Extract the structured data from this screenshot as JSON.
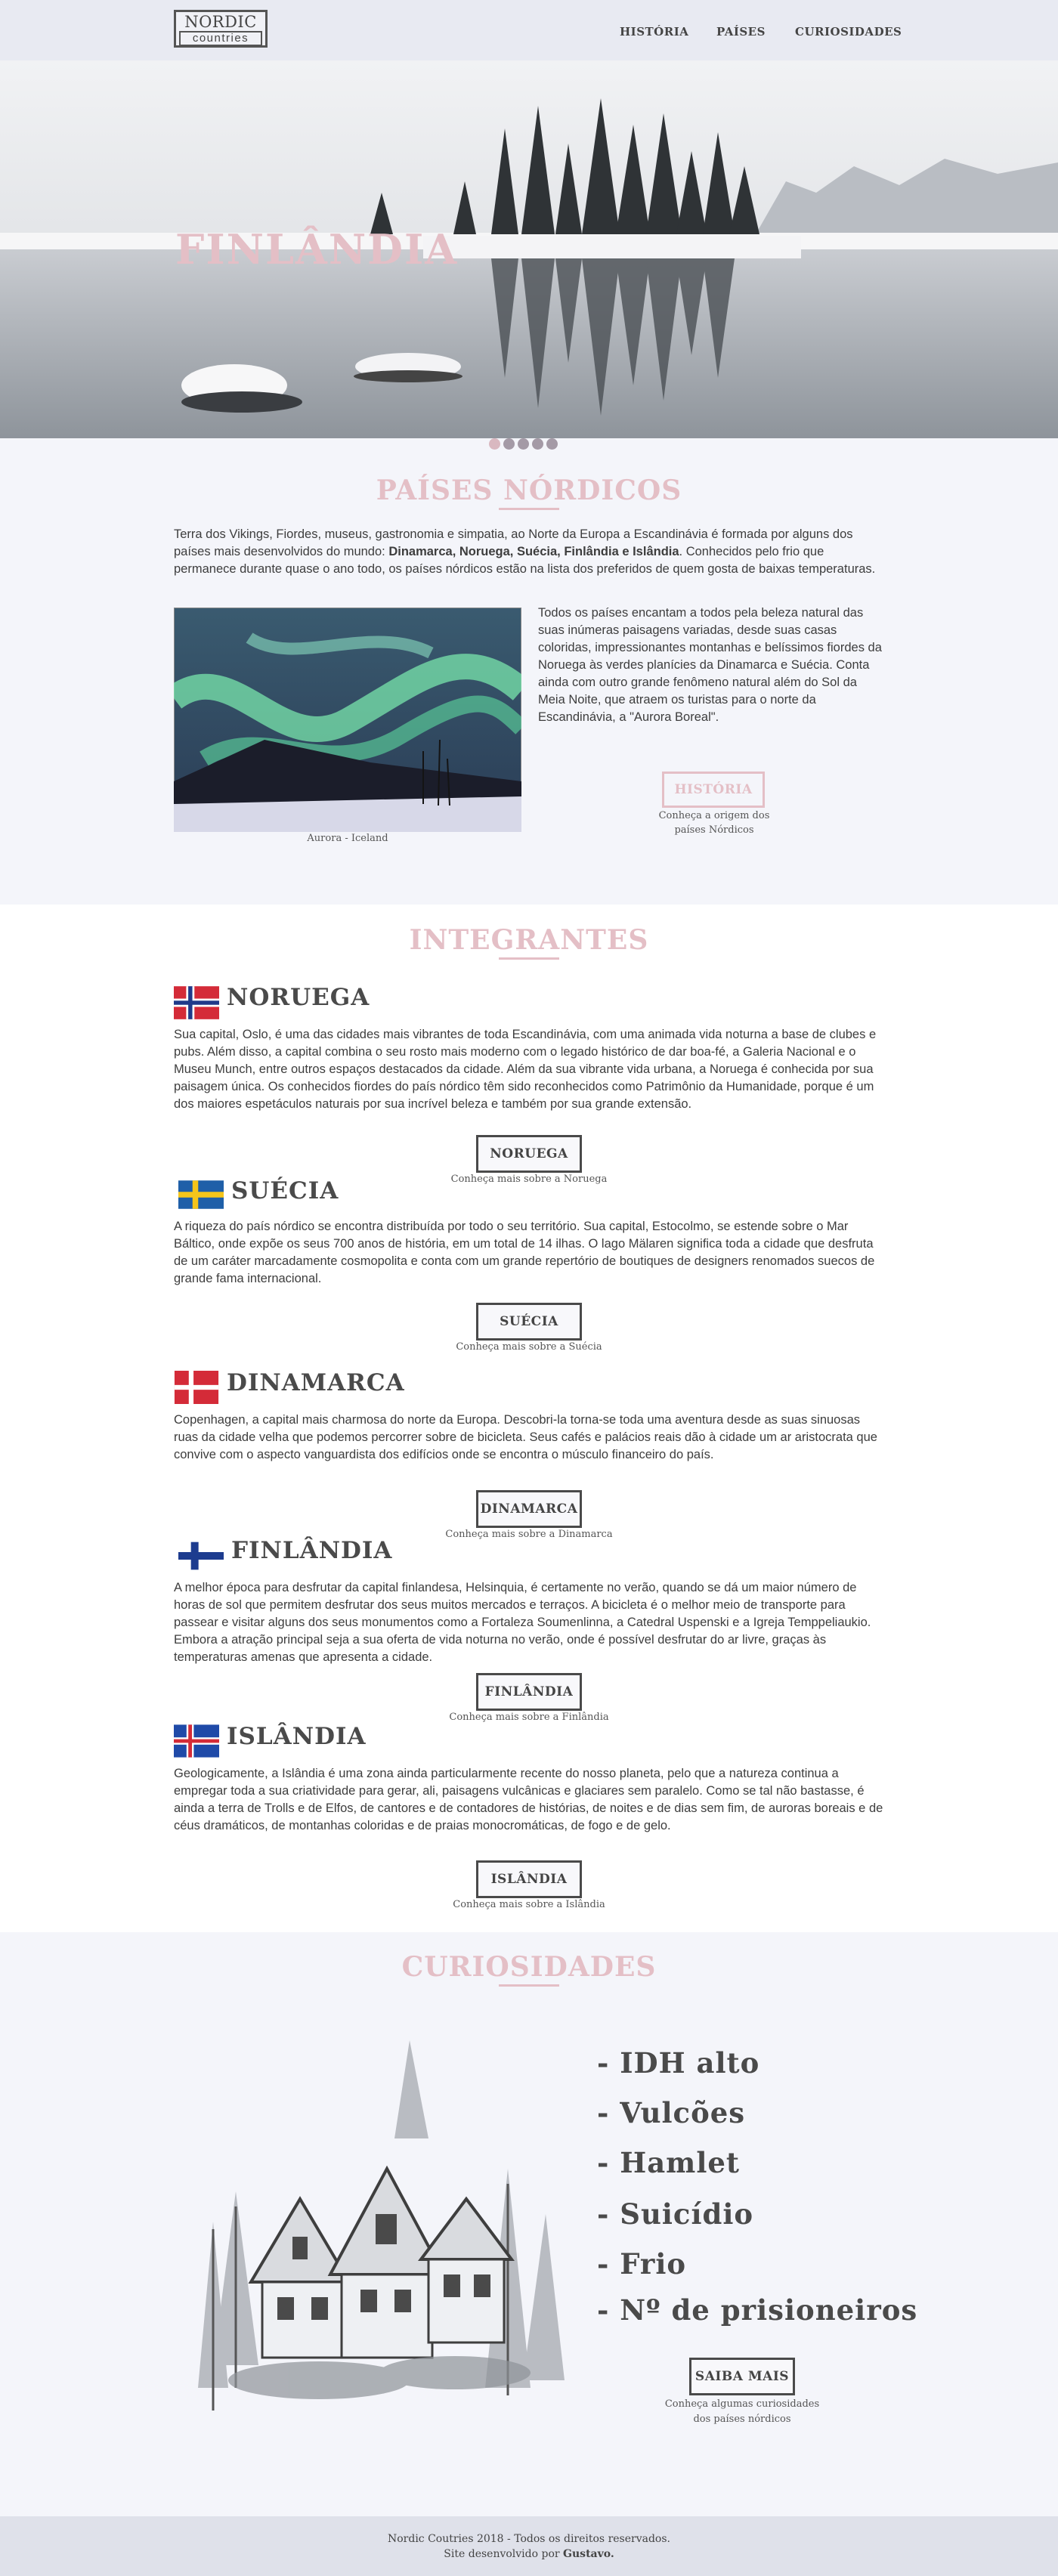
{
  "header": {
    "logo": {
      "line1": "NORDIC",
      "line2": "countries"
    },
    "nav": [
      {
        "label": "HISTÓRIA"
      },
      {
        "label": "PAÍSES"
      },
      {
        "label": "CURIOSIDADES"
      }
    ]
  },
  "hero": {
    "title": "FINLÂNDIA",
    "slides": 5,
    "active_slide": 1
  },
  "nordic": {
    "title": "PAÍSES NÓRDICOS",
    "intro_start": "Terra dos Vikings, Fiordes, museus, gastronomia e simpatia, ao Norte da Europa a Escandinávia é formada por alguns dos países mais desenvolvidos do mundo: ",
    "intro_bold": "Dinamarca, Noruega, Suécia, Finlândia e Islândia",
    "intro_end": ". Conhecidos pelo frio que permanece durante quase o ano todo, os países nórdicos estão na lista dos preferidos de quem gosta de baixas temperaturas.",
    "body": "Todos os países encantam a todos pela beleza natural das suas inúmeras paisagens variadas, desde suas casas coloridas, impressionantes montanhas e belíssimos fiordes da Noruega às verdes planícies da Dinamarca e Suécia. Conta ainda com outro grande fenômeno natural além do Sol da Meia Noite, que atraem os turistas para o norte da Escandinávia, a \"Aurora Boreal\".",
    "image_caption": "Aurora - Iceland",
    "button": "HISTÓRIA",
    "button_caption": "Conheça a origem dos países Nórdicos"
  },
  "members": {
    "title": "INTEGRANTES",
    "countries": [
      {
        "name": "NORUEGA",
        "text": "Sua capital, Oslo, é uma das cidades mais vibrantes de toda Escandinávia, com uma animada vida noturna a base de clubes e pubs. Além disso, a capital combina o seu rosto mais moderno com o legado histórico de dar boa-fé, a Galeria Nacional e o Museu Munch, entre outros espaços destacados da cidade. Além da sua vibrante vida urbana, a Noruega é conhecida por sua paisagem única. Os conhecidos fiordes do país nórdico têm sido reconhecidos como Patrimônio da Humanidade, porque é um dos maiores espetáculos naturais por sua incrível beleza e também por sua grande extensão.",
        "button": "NORUEGA",
        "caption": "Conheça mais sobre a Noruega"
      },
      {
        "name": "SUÉCIA",
        "text": "A riqueza do país nórdico se encontra distribuída por todo o seu território. Sua capital, Estocolmo, se estende sobre o Mar Báltico, onde expõe os seus 700 anos de história, em um total de 14 ilhas. O lago Mälaren significa toda a cidade que desfruta de um caráter marcadamente cosmopolita e conta com um grande repertório de boutiques de designers renomados suecos de grande fama internacional.",
        "button": "SUÉCIA",
        "caption": "Conheça mais sobre a Suécia"
      },
      {
        "name": "DINAMARCA",
        "text": "Copenhagen, a capital mais charmosa do norte da Europa. Descobri-la torna-se toda uma aventura desde as suas sinuosas ruas da cidade velha que podemos percorrer sobre de bicicleta. Seus cafés e palácios reais dão à cidade um ar aristocrata que convive com o aspecto vanguardista dos edifícios onde se encontra o músculo financeiro do país.",
        "button": "DINAMARCA",
        "caption": "Conheça mais sobre a Dinamarca"
      },
      {
        "name": "FINLÂNDIA",
        "text": "A melhor época para desfrutar da capital finlandesa, Helsinquia, é certamente no verão, quando se dá um maior número de horas de sol que permitem desfrutar dos seus muitos mercados e terraços. A bicicleta é o melhor meio de transporte para passear e visitar alguns dos seus monumentos como a Fortaleza Soumenlinna, a Catedral Uspenski e a Igreja Temppeliaukio. Embora a atração principal seja a sua oferta de vida noturna no verão, onde é possível desfrutar do ar livre, graças às temperaturas amenas que apresenta a cidade.",
        "button": "FINLÂNDIA",
        "caption": "Conheça mais sobre a Finlândia"
      },
      {
        "name": "ISLÂNDIA",
        "text": "Geologicamente, a Islândia é uma zona ainda particularmente recente do nosso planeta, pelo que a natureza continua a empregar toda a sua criatividade para gerar, ali, paisagens vulcânicas e glaciares sem paralelo. Como se tal não bastasse, é ainda a terra de Trolls e de Elfos, de cantores e de contadores de histórias, de noites e de dias sem fim, de auroras boreais e de céus dramáticos, de montanhas coloridas e de praias monocromáticas, de fogo e de gelo.",
        "button": "ISLÂNDIA",
        "caption": "Conheça mais sobre a Islândia"
      }
    ]
  },
  "curiosities": {
    "title": "CURIOSIDADES",
    "items": [
      "- IDH alto",
      "- Vulcões",
      "- Hamlet",
      "- Suicídio",
      "- Frio",
      "- Nº de prisioneiros"
    ],
    "button": "SAIBA MAIS",
    "caption": "Conheça algumas curiosidades dos países nórdicos"
  },
  "footer": {
    "line1": "Nordic Coutries 2018 - Todos os direitos reservados.",
    "line2_prefix": "Site desenvolvido por ",
    "line2_author": "Gustavo."
  }
}
